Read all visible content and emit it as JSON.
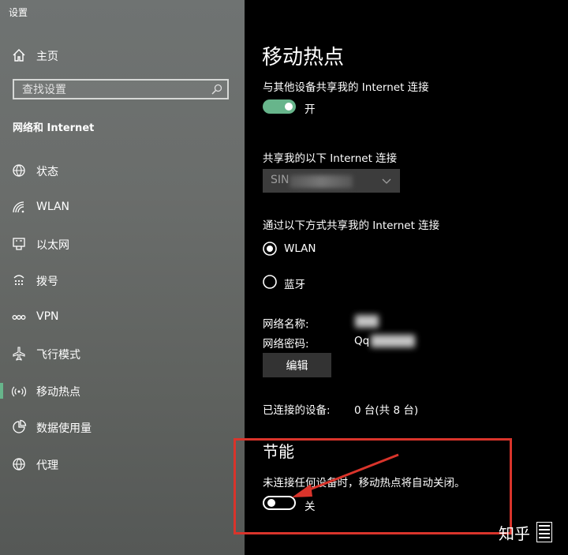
{
  "app_title": "设置",
  "sidebar": {
    "home": "主页",
    "search_placeholder": "查找设置",
    "section": "网络和 Internet",
    "items": [
      {
        "label": "状态",
        "icon": "globe-status-icon"
      },
      {
        "label": "WLAN",
        "icon": "wifi-icon"
      },
      {
        "label": "以太网",
        "icon": "ethernet-icon"
      },
      {
        "label": "拨号",
        "icon": "dialup-icon"
      },
      {
        "label": "VPN",
        "icon": "vpn-icon"
      },
      {
        "label": "飞行模式",
        "icon": "airplane-icon"
      },
      {
        "label": "移动热点",
        "icon": "hotspot-icon",
        "selected": true
      },
      {
        "label": "数据使用量",
        "icon": "data-usage-icon"
      },
      {
        "label": "代理",
        "icon": "globe-icon"
      }
    ]
  },
  "main": {
    "title": "移动热点",
    "share_label": "与其他设备共享我的 Internet 连接",
    "share_state": "开",
    "share_from_label": "共享我的以下 Internet 连接",
    "share_from_value": "SIN",
    "share_over_label": "通过以下方式共享我的 Internet 连接",
    "share_over_options": [
      "WLAN",
      "蓝牙"
    ],
    "share_over_selected": "WLAN",
    "network_name_label": "网络名称:",
    "network_password_label": "网络密码:",
    "network_password_value": "Qq",
    "edit_button": "编辑",
    "connected_label": "已连接的设备:",
    "connected_value": "0 台(共 8 台)",
    "power_title": "节能",
    "power_desc": "未连接任何设备时，移动热点将自动关闭。",
    "power_state": "关"
  },
  "watermark": "知乎",
  "colors": {
    "accent": "#67b58b",
    "annotation": "#d9342b"
  }
}
